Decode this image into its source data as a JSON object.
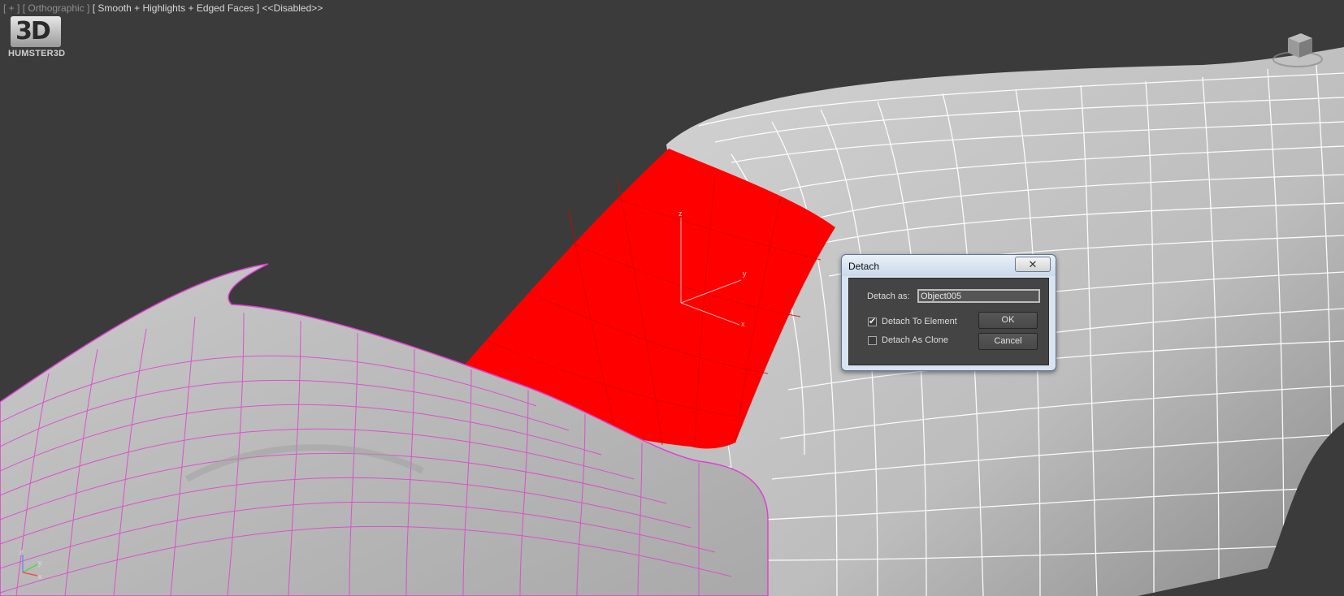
{
  "viewport": {
    "label_bracket": "[ + ]",
    "label_view": "[ Orthographic ]",
    "label_shading": "[ Smooth + Highlights + Edged Faces ]",
    "label_status": "<<Disabled>>",
    "gizmo_axes": {
      "z": "z",
      "y": "y",
      "x": "x"
    },
    "tripod_axes": {
      "z": "z",
      "y": "y",
      "x": "x"
    }
  },
  "logo": {
    "mark": "3D",
    "text": "HUMSTER3D"
  },
  "colors": {
    "selection": "#ff0000",
    "background": "#3b3b3b",
    "wire_selected": "#e040d0",
    "wire_default": "#ffffff"
  },
  "icons": {
    "viewcube": "viewcube-icon",
    "close": "close-icon",
    "check": "checkmark-icon"
  },
  "dialog": {
    "title": "Detach",
    "close_glyph": "✕",
    "detach_as_label": "Detach as:",
    "detach_as_value": "Object005",
    "detach_to_element_label": "Detach To Element",
    "detach_to_element_checked": true,
    "detach_as_clone_label": "Detach As Clone",
    "detach_as_clone_checked": false,
    "ok_label": "OK",
    "cancel_label": "Cancel"
  }
}
